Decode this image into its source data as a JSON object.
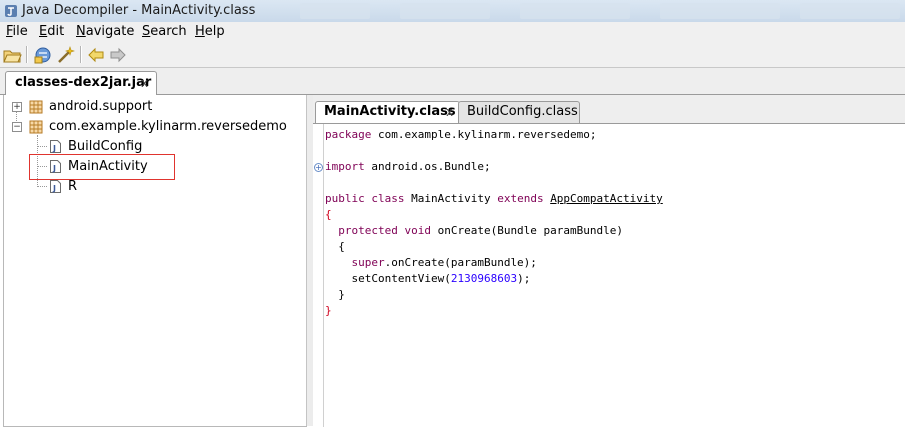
{
  "window": {
    "title": "Java Decompiler - MainActivity.class"
  },
  "menu": {
    "items": [
      {
        "key": "F",
        "rest": "ile"
      },
      {
        "key": "E",
        "rest": "dit"
      },
      {
        "key": "N",
        "rest": "avigate"
      },
      {
        "key": "S",
        "rest": "earch"
      },
      {
        "key": "H",
        "rest": "elp"
      }
    ]
  },
  "toolbar": {
    "icons": [
      "open-file-icon",
      "open-type-icon",
      "magic-wand-icon",
      "back-arrow-icon",
      "forward-arrow-icon"
    ]
  },
  "jar_tab": {
    "label": "classes-dex2jar.jar",
    "close": "x"
  },
  "tree": {
    "nodes": [
      {
        "label": "android.support",
        "type": "package",
        "expander": "+"
      },
      {
        "label": "com.example.kylinarm.reversedemo",
        "type": "package",
        "expander": "−"
      },
      {
        "label": "BuildConfig",
        "type": "class"
      },
      {
        "label": "MainActivity",
        "type": "class",
        "selected": true
      },
      {
        "label": "R",
        "type": "class"
      }
    ]
  },
  "editor": {
    "tabs": [
      {
        "label": "MainActivity.class",
        "active": true,
        "close": "x"
      },
      {
        "label": "BuildConfig.class",
        "active": false
      }
    ],
    "fold_marker": "+",
    "code": {
      "l1_kw": "package",
      "l1_rest": " com.example.kylinarm.reversedemo;",
      "l3_kw": "import",
      "l3_rest": " android.os.Bundle;",
      "l5_kw1": "public class",
      "l5_mid": " MainActivity ",
      "l5_kw2": "extends",
      "l5_sp": " ",
      "l5_link": "AppCompatActivity",
      "l6": "{",
      "l7_kw": "  protected void",
      "l7_rest": " onCreate(Bundle paramBundle)",
      "l8": "  {",
      "l9_kw": "    super",
      "l9_rest": ".onCreate(paramBundle);",
      "l10_a": "    setContentView(",
      "l10_num": "2130968603",
      "l10_b": ");",
      "l11": "  }",
      "l12": "}"
    }
  },
  "colors": {
    "keyword": "#7f0055",
    "number": "#2a00ff",
    "brace": "#d0001c",
    "selection_box": "#e0342e"
  }
}
